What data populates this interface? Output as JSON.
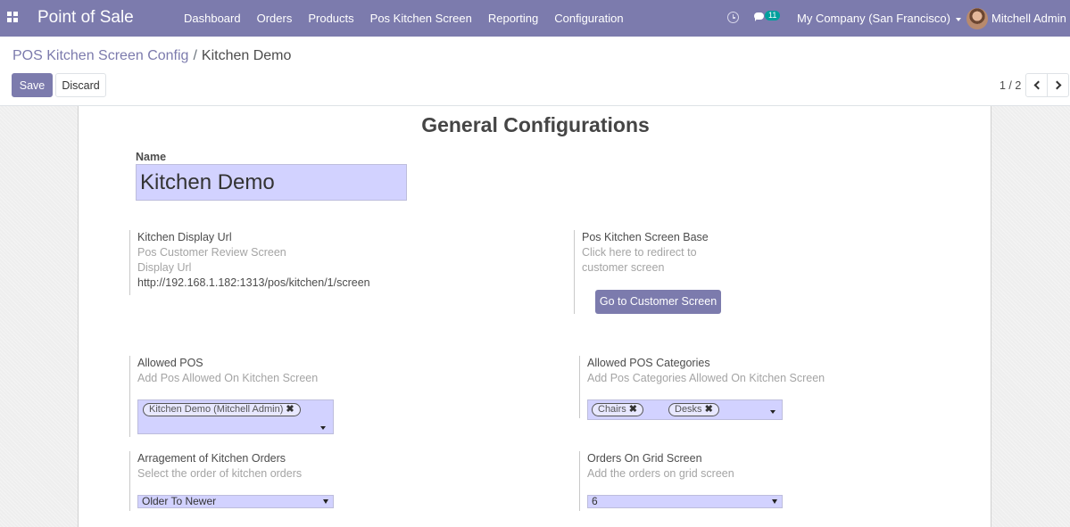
{
  "navbar": {
    "brand": "Point of Sale",
    "menu": [
      "Dashboard",
      "Orders",
      "Products",
      "Pos Kitchen Screen",
      "Reporting",
      "Configuration"
    ],
    "message_count": "11",
    "company": "My Company (San Francisco)",
    "user": "Mitchell Admin",
    "color": "#7c7bad"
  },
  "control_panel": {
    "breadcrumb_parent": "POS Kitchen Screen Config",
    "breadcrumb_separator": "/",
    "breadcrumb_current": "Kitchen Demo",
    "save_label": "Save",
    "discard_label": "Discard",
    "pager": "1 / 2"
  },
  "form": {
    "title": "General Configurations",
    "name_label": "Name",
    "name_value": "Kitchen Demo",
    "kitchen_url": {
      "label": "Kitchen Display Url",
      "help": "Pos Customer Review Screen Display Url",
      "value": "http://192.168.1.182:1313/pos/kitchen/1/screen"
    },
    "screen_base": {
      "label": "Pos Kitchen Screen Base",
      "help": "Click here to redirect to customer screen",
      "button": "Go to Customer Screen"
    },
    "allowed_pos": {
      "label": "Allowed POS",
      "help": "Add Pos Allowed On Kitchen Screen",
      "tags": [
        "Kitchen Demo (Mitchell Admin)"
      ]
    },
    "allowed_categories": {
      "label": "Allowed POS Categories",
      "help": "Add Pos Categories Allowed On Kitchen Screen",
      "tags": [
        "Chairs",
        "Desks"
      ]
    },
    "arrangement": {
      "label": "Arragement of Kitchen Orders",
      "help": "Select the order of kitchen orders",
      "value": "Older To Newer"
    },
    "grid_orders": {
      "label": "Orders On Grid Screen",
      "help": "Add the orders on grid screen",
      "value": "6"
    }
  }
}
